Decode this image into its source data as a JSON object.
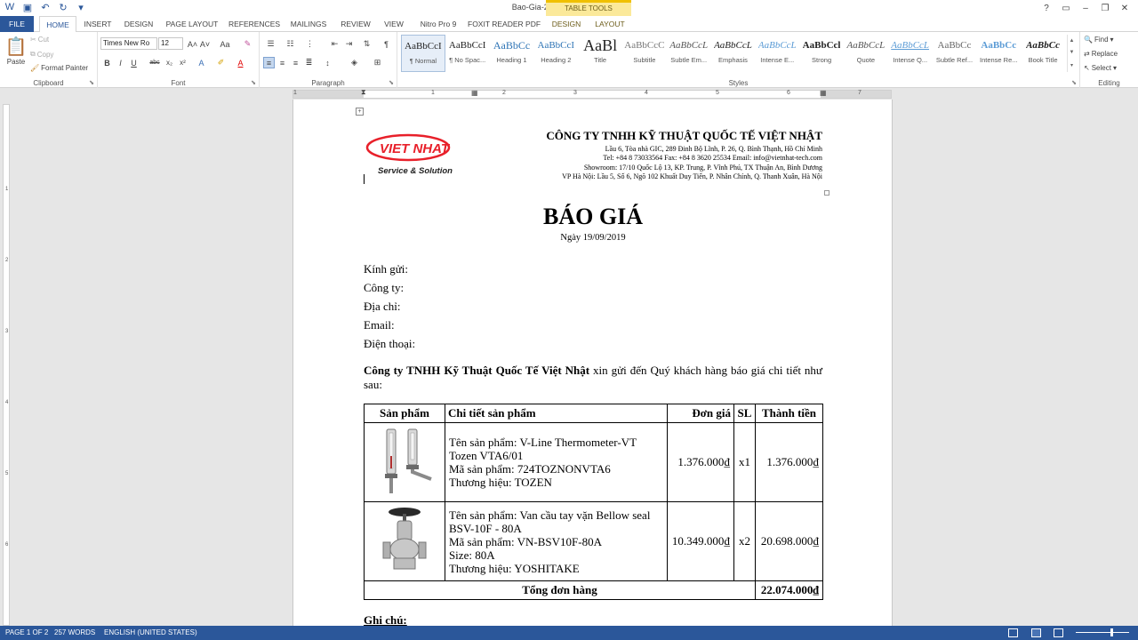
{
  "window": {
    "title": "Bao-Gia-2019-09-19.doc - Word",
    "contextual_group": "TABLE TOOLS",
    "help": "?"
  },
  "tabs": [
    "FILE",
    "HOME",
    "INSERT",
    "DESIGN",
    "PAGE LAYOUT",
    "REFERENCES",
    "MAILINGS",
    "REVIEW",
    "VIEW",
    "Nitro Pro 9",
    "FOXIT READER PDF",
    "DESIGN",
    "LAYOUT"
  ],
  "ribbon": {
    "clipboard": {
      "label": "Clipboard",
      "paste": "Paste",
      "cut": "Cut",
      "copy": "Copy",
      "format_painter": "Format Painter"
    },
    "font": {
      "label": "Font",
      "font_name": "Times New Ro",
      "font_size": "12",
      "bold": "B",
      "italic": "I",
      "underline": "U",
      "strike": "abc",
      "subscript": "x₂",
      "superscript": "x²",
      "case": "Aa"
    },
    "paragraph": {
      "label": "Paragraph"
    },
    "styles": {
      "label": "Styles",
      "items": [
        {
          "preview": "AaBbCcI",
          "name": "¶ Normal"
        },
        {
          "preview": "AaBbCcI",
          "name": "¶ No Spac..."
        },
        {
          "preview": "AaBbCc",
          "name": "Heading 1"
        },
        {
          "preview": "AaBbCcI",
          "name": "Heading 2"
        },
        {
          "preview": "AaBl",
          "name": "Title"
        },
        {
          "preview": "AaBbCcC",
          "name": "Subtitle"
        },
        {
          "preview": "AaBbCcL",
          "name": "Subtle Em..."
        },
        {
          "preview": "AaBbCcL",
          "name": "Emphasis"
        },
        {
          "preview": "AaBbCcL",
          "name": "Intense E..."
        },
        {
          "preview": "AaBbCcl",
          "name": "Strong"
        },
        {
          "preview": "AaBbCcL",
          "name": "Quote"
        },
        {
          "preview": "AaBbCcL",
          "name": "Intense Q..."
        },
        {
          "preview": "AaBbCc",
          "name": "Subtle Ref..."
        },
        {
          "preview": "AaBbCc",
          "name": "Intense Re..."
        },
        {
          "preview": "AaBbCc",
          "name": "Book Title"
        }
      ]
    },
    "editing": {
      "label": "Editing",
      "find": "Find",
      "replace": "Replace",
      "select": "Select"
    }
  },
  "ruler": [
    "1",
    "1",
    "2",
    "3",
    "4",
    "5",
    "6",
    "7"
  ],
  "vruler": [
    "1",
    "2",
    "3",
    "4",
    "5",
    "6"
  ],
  "document": {
    "logo_top": "VIET NHAT",
    "logo_bottom": "Service & Solution",
    "company_name": "CÔNG TY TNHH KỸ THUẬT QUỐC TẾ VIỆT NHẬT",
    "address_lines": [
      "Lầu 6, Tòa nhà GIC, 289 Đinh Bộ Lĩnh, P. 26, Q. Bình Thạnh, Hồ Chí Minh",
      "Tel: +84 8 73033564 Fax: +84 8 3620 25534 Email: info@vietnhat-tech.com",
      "Showroom: 17/10 Quốc Lộ 13, KP. Trung, P. Vĩnh Phú, TX Thuận An, Bình Dương",
      "VP Hà Nội: Lầu 5, Số 6, Ngõ 102 Khuất Duy Tiến, P. Nhân Chính, Q. Thanh Xuân, Hà Nội"
    ],
    "heading": "BÁO GIÁ",
    "date": "Ngày 19/09/2019",
    "fields": [
      "Kính gửi:",
      "Công ty:",
      "Địa chỉ:",
      "Email:",
      "Điện thoại:"
    ],
    "intro_bold": "Công ty TNHH Kỹ Thuật Quốc Tế Việt Nhật",
    "intro_rest": " xin gửi đến Quý khách hàng báo giá chi tiết như sau:",
    "table": {
      "headers": [
        "Sản phẩm",
        "Chi tiết sản phẩm",
        "Đơn giá",
        "SL",
        "Thành tiền"
      ],
      "rows": [
        {
          "details": [
            "Tên sản phẩm: V-Line Thermometer-VT Tozen VTA6/01",
            "Mã sản phẩm: 724TOZNONVTA6",
            "Thương hiệu: TOZEN"
          ],
          "price": "1.376.000₫",
          "qty": "x1",
          "total": "1.376.000₫"
        },
        {
          "details": [
            "Tên sản phẩm: Van cầu tay vặn Bellow seal BSV-10F - 80A",
            "Mã sản phẩm: VN-BSV10F-80A",
            "Size: 80A",
            "Thương hiệu: YOSHITAKE"
          ],
          "price": "10.349.000₫",
          "qty": "x2",
          "total": "20.698.000₫"
        }
      ],
      "total_label": "Tổng đơn hàng",
      "total_value": "22.074.000₫"
    },
    "notes_heading": "Ghi chú:"
  },
  "status": {
    "page": "PAGE 1 OF 2",
    "words": "257 WORDS",
    "language": "ENGLISH (UNITED STATES)"
  },
  "colors": {
    "accent": "#2b579a",
    "total_red": "#e00000",
    "logo_red": "#e8202a"
  }
}
